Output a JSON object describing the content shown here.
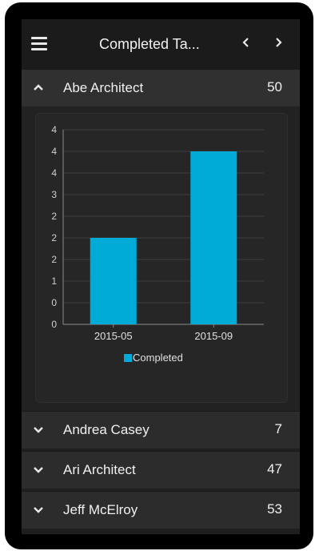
{
  "header": {
    "title": "Completed Ta...",
    "menu_icon": "hamburger-menu-icon",
    "prev_icon": "chevron-left-icon",
    "next_icon": "chevron-right-icon"
  },
  "expanded_item": {
    "name": "Abe Architect",
    "count": "50",
    "chevron": "chevron-up-icon"
  },
  "chart_data": {
    "type": "bar",
    "categories": [
      "2015-05",
      "2015-09"
    ],
    "series": [
      {
        "name": "Completed",
        "values": [
          2,
          4
        ],
        "color": "#00acd7"
      }
    ],
    "y_tick_labels": [
      "0",
      "0",
      "1",
      "2",
      "2",
      "2",
      "3",
      "4",
      "4",
      "4"
    ],
    "ylim": [
      0,
      4.5
    ],
    "grid": true,
    "legend": "bottom"
  },
  "collapsed_items": [
    {
      "name": "Andrea Casey",
      "count": "7",
      "chevron": "chevron-down-icon"
    },
    {
      "name": "Ari Architect",
      "count": "47",
      "chevron": "chevron-down-icon"
    },
    {
      "name": "Jeff McElroy",
      "count": "53",
      "chevron": "chevron-down-icon"
    }
  ],
  "scrollbar": {
    "up_arrow": "^",
    "down_arrow": "v"
  },
  "colors": {
    "accent": "#00acd7",
    "header_bg": "#1b1b1b",
    "row_bg": "#2c2c2c",
    "panel_bg": "#262626"
  }
}
